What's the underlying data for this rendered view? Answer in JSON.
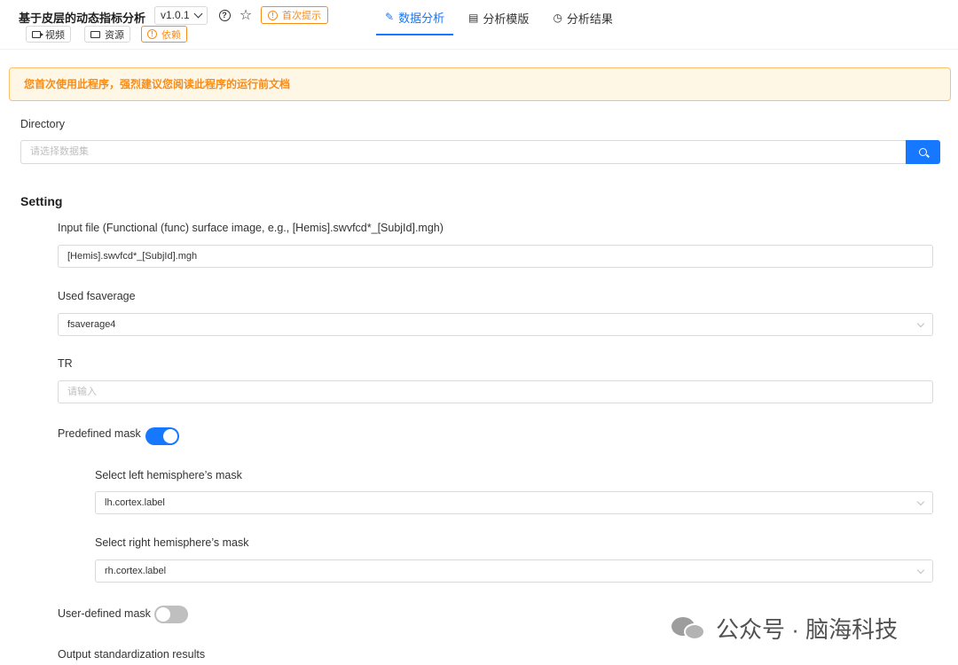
{
  "app": {
    "title": "基于皮层的动态指标分析",
    "version": "v1.0.1",
    "tip_label": "首次提示",
    "video_label": "视频",
    "resource_label": "资源",
    "dependency_label": "依赖"
  },
  "tabs": [
    {
      "label": "数据分析",
      "icon": "edit-icon",
      "active": true
    },
    {
      "label": "分析模版",
      "icon": "document-icon",
      "active": false
    },
    {
      "label": "分析结果",
      "icon": "history-icon",
      "active": false
    }
  ],
  "alert": {
    "text": "您首次使用此程序，强烈建议您阅读此程序的运行前文档"
  },
  "directory": {
    "label": "Directory",
    "placeholder": "请选择数据集"
  },
  "setting": {
    "title": "Setting",
    "input_file": {
      "label": "Input file (Functional (func) surface image, e.g., [Hemis].swvfcd*_[SubjId].mgh)",
      "value": "[Hemis].swvfcd*_[SubjId].mgh"
    },
    "fsaverage": {
      "label": "Used fsaverage",
      "value": "fsaverage4"
    },
    "tr": {
      "label": "TR",
      "placeholder": "请输入"
    },
    "predefined_mask": {
      "label": "Predefined mask",
      "enabled": true
    },
    "left_mask": {
      "label": "Select left hemisphere’s mask",
      "value": "lh.cortex.label"
    },
    "right_mask": {
      "label": "Select right hemisphere’s mask",
      "value": "rh.cortex.label"
    },
    "user_mask": {
      "label": "User-defined mask",
      "enabled": false
    },
    "output_std": {
      "label": "Output standardization results"
    }
  },
  "watermark": {
    "text": "公众号 · 脑海科技"
  },
  "colors": {
    "primary": "#1677ff",
    "warning": "#fa8c16",
    "alert_bg": "#fff7e6"
  }
}
